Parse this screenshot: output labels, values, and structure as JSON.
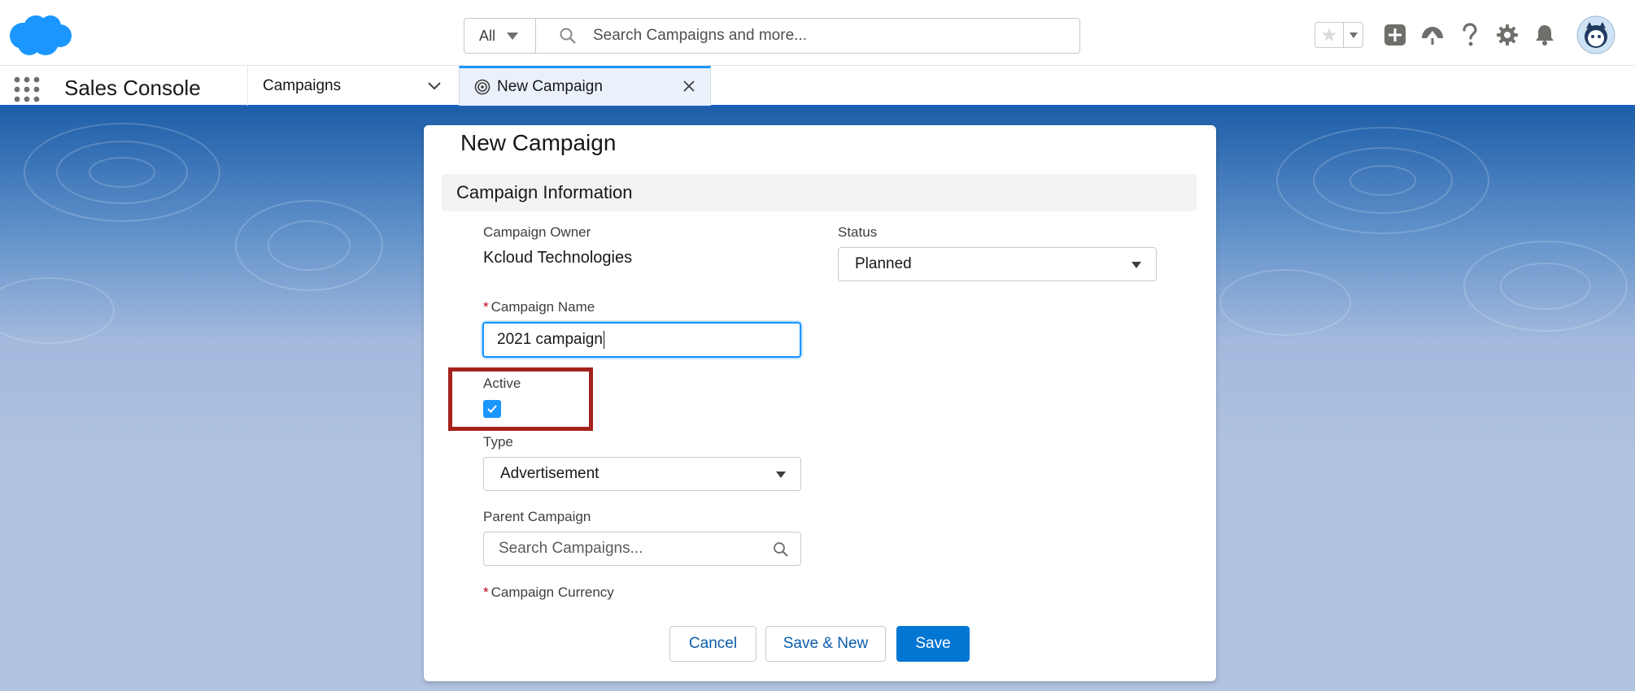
{
  "header": {
    "search_scope": "All",
    "search_placeholder": "Search Campaigns and more..."
  },
  "nav": {
    "app_name": "Sales Console",
    "object_tab": "Campaigns",
    "workspace_tab": "New Campaign"
  },
  "modal": {
    "title": "New Campaign",
    "section": "Campaign Information",
    "owner_label": "Campaign Owner",
    "owner_value": "Kcloud Technologies",
    "status_label": "Status",
    "status_value": "Planned",
    "name_label": "Campaign Name",
    "name_value": "2021 campaign",
    "active_label": "Active",
    "active_checked": true,
    "type_label": "Type",
    "type_value": "Advertisement",
    "parent_label": "Parent Campaign",
    "parent_placeholder": "Search Campaigns...",
    "currency_label": "Campaign Currency"
  },
  "buttons": {
    "cancel": "Cancel",
    "save_new": "Save & New",
    "save": "Save"
  },
  "colors": {
    "brand": "#0176d3",
    "focus": "#1b96ff",
    "highlight": "#a4221c",
    "required": "#ba0517"
  }
}
